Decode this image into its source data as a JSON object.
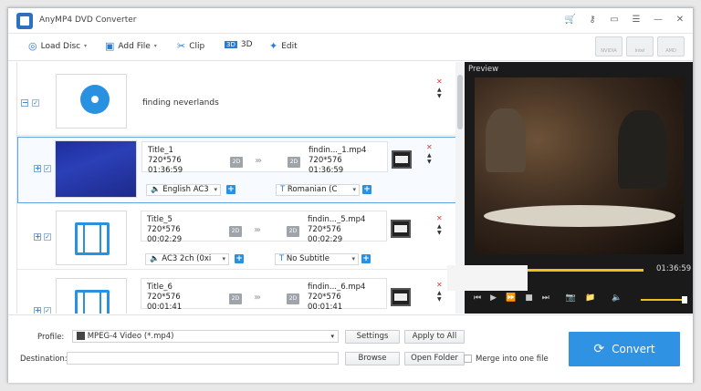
{
  "app": {
    "title": "AnyMP4 DVD Converter"
  },
  "toolbar": {
    "load_disc": "Load Disc",
    "add_file": "Add File",
    "clip": "Clip",
    "three_d": "3D",
    "edit": "Edit"
  },
  "hw": {
    "a": "NVIDIA",
    "b": "Intel",
    "c": "AMD"
  },
  "disc": {
    "name": "finding neverlands"
  },
  "titles": [
    {
      "name": "Title_1",
      "res": "720*576",
      "dur": "01:36:59",
      "out_name": "findin..._1.mp4",
      "out_res": "720*576",
      "out_dur": "01:36:59",
      "audio": "English AC3",
      "subtitle": "Romanian (C",
      "badge": "2D"
    },
    {
      "name": "Title_5",
      "res": "720*576",
      "dur": "00:02:29",
      "out_name": "findin..._5.mp4",
      "out_res": "720*576",
      "out_dur": "00:02:29",
      "audio": "AC3 2ch (0xi",
      "subtitle": "No Subtitle",
      "badge": "2D"
    },
    {
      "name": "Title_6",
      "res": "720*576",
      "dur": "00:01:41",
      "out_name": "findin..._6.mp4",
      "out_res": "720*576",
      "out_dur": "00:01:41",
      "badge": "2D"
    }
  ],
  "preview": {
    "label": "Preview",
    "time": "01:36:59",
    "progress": 0.42,
    "volume": 0.9
  },
  "bottom": {
    "profile_label": "Profile:",
    "profile_value": "MPEG-4 Video (*.mp4)",
    "settings": "Settings",
    "apply_all": "Apply to All",
    "dest_label": "Destination:",
    "browse": "Browse",
    "open_folder": "Open Folder",
    "merge": "Merge into one file",
    "convert": "Convert"
  },
  "colors": {
    "accent": "#2f92e2",
    "seek": "#f0c020"
  }
}
